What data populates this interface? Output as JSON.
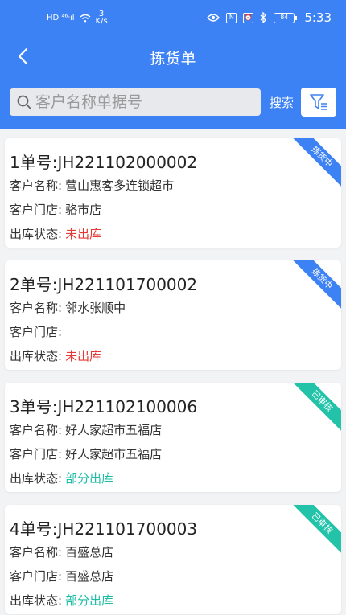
{
  "statusbar": {
    "left_text": "HD ⁴⁶ᐧıl",
    "speed_value": "3",
    "speed_unit": "K/s",
    "battery": "84",
    "time": "5:33"
  },
  "navbar": {
    "title": "拣货单"
  },
  "search": {
    "placeholder": "客户名称单据号",
    "button_label": "搜索"
  },
  "labels": {
    "customer_name": "客户名称:",
    "customer_store": "客户门店:",
    "outbound_status": "出库状态:"
  },
  "colors": {
    "primary": "#3d82f4",
    "status_unshipped": "#e53935",
    "status_partial": "#1fbda6",
    "ribbon_picking": "#3d82f4",
    "ribbon_reviewed": "#22c3a8"
  },
  "orders": [
    {
      "title": "1单号:JH221102000002",
      "customer_name": "营山惠客多连锁超市",
      "customer_store": "骆市店",
      "status": "未出库",
      "ribbon": "拣货中"
    },
    {
      "title": "2单号:JH221101700002",
      "customer_name": "邻水张顺中",
      "customer_store": "",
      "status": "未出库",
      "ribbon": "拣货中"
    },
    {
      "title": "3单号:JH221102100006",
      "customer_name": "好人家超市五福店",
      "customer_store": "好人家超市五福店",
      "status": "部分出库",
      "ribbon": "已审核"
    },
    {
      "title": "4单号:JH221101700003",
      "customer_name": "百盛总店",
      "customer_store": "百盛总店",
      "status": "部分出库",
      "ribbon": "已审核"
    }
  ]
}
